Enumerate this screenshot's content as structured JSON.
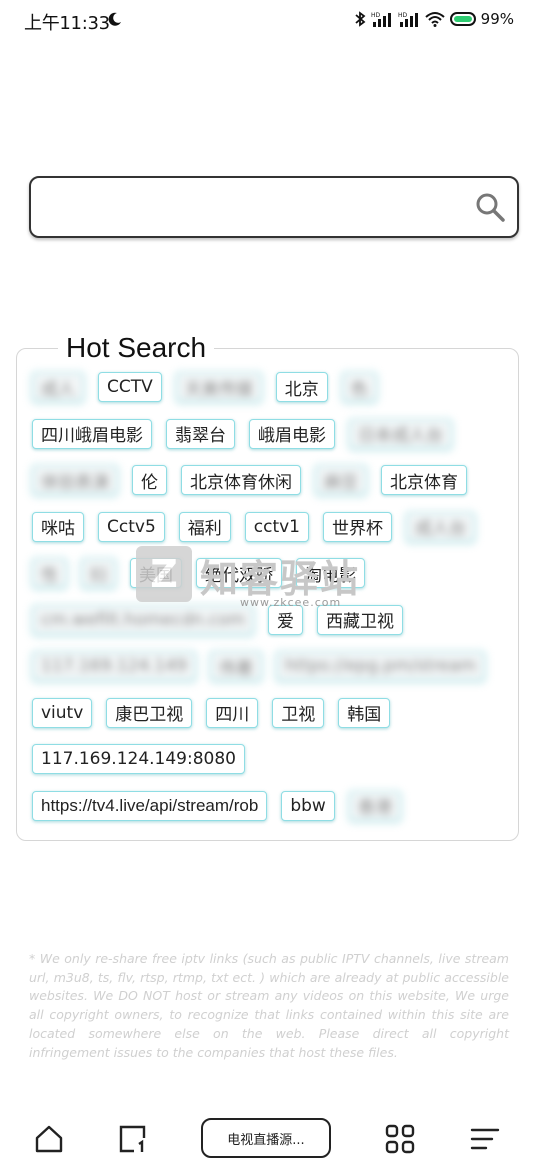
{
  "status_bar": {
    "time": "上午11:33",
    "icons": [
      "moon-icon",
      "bluetooth-icon",
      "hd-signal-icon",
      "hd-signal-icon",
      "wifi-icon",
      "battery-icon"
    ],
    "battery": "99%"
  },
  "search": {
    "placeholder": "",
    "value": "",
    "icon": "search-icon"
  },
  "hot_search": {
    "title": "Hot Search",
    "rows": [
      [
        {
          "text": "成人",
          "blur": true
        },
        {
          "text": "CCTV"
        },
        {
          "text": "天美传媒",
          "blur": true
        },
        {
          "text": "北京"
        },
        {
          "text": "色",
          "blur": true
        }
      ],
      [
        {
          "text": "四川峨眉电影"
        },
        {
          "text": "翡翠台"
        },
        {
          "text": "峨眉电影"
        },
        {
          "text": "日本成人台",
          "blur": true
        }
      ],
      [
        {
          "text": "体验表演",
          "blur": true
        },
        {
          "text": "伦"
        },
        {
          "text": "北京体育休闲"
        },
        {
          "text": "麻豆",
          "blur": true
        },
        {
          "text": "北京体育"
        }
      ],
      [
        {
          "text": "咪咕"
        },
        {
          "text": "Cctv5"
        },
        {
          "text": "福利"
        },
        {
          "text": "cctv1"
        },
        {
          "text": "世界杯"
        },
        {
          "text": "成人台",
          "blur": true
        }
      ],
      [
        {
          "text": "性",
          "blur": true
        },
        {
          "text": "妇",
          "blur": true
        },
        {
          "text": "美国"
        },
        {
          "text": "绝代双骄"
        },
        {
          "text": "淘电影"
        }
      ],
      [
        {
          "text": "cm.wefilt.homecdn.com",
          "blur": true
        },
        {
          "text": "爱"
        },
        {
          "text": "西藏卫视"
        }
      ],
      [
        {
          "text": "117.169.124.149",
          "blur": true
        },
        {
          "text": "伟著",
          "blur": true
        },
        {
          "text": "https://epg.pm/stream",
          "blur": true
        }
      ],
      [
        {
          "text": "viutv"
        },
        {
          "text": "康巴卫视"
        },
        {
          "text": "四川"
        },
        {
          "text": "卫视"
        },
        {
          "text": "韩国"
        }
      ],
      [
        {
          "text": "117.169.124.149:8080"
        }
      ],
      [
        {
          "text": "https://tv4.live/api/stream/rob",
          "long": true
        },
        {
          "text": "bbw"
        },
        {
          "text": "香港",
          "blur": true
        }
      ]
    ]
  },
  "watermark": {
    "logo": "Z",
    "name": "知客驿站",
    "url": "www.zkcee.com"
  },
  "disclaimer": "* We only re-share free iptv links (such as public IPTV channels, live stream url, m3u8, ts, flv, rtsp, rtmp, txt ect. ) which are already at public accessible websites. We DO NOT host or stream any videos on this website, We urge all copyright owners, to recognize that links contained within this site are located somewhere else on the web. Please direct all copyright infringement issues to the companies that host these files.",
  "bottom_nav": {
    "home": "home-icon",
    "tabs": "tabs-icon",
    "channel_label": "电视直播源...",
    "apps": "apps-grid-icon",
    "menu": "menu-icon"
  }
}
